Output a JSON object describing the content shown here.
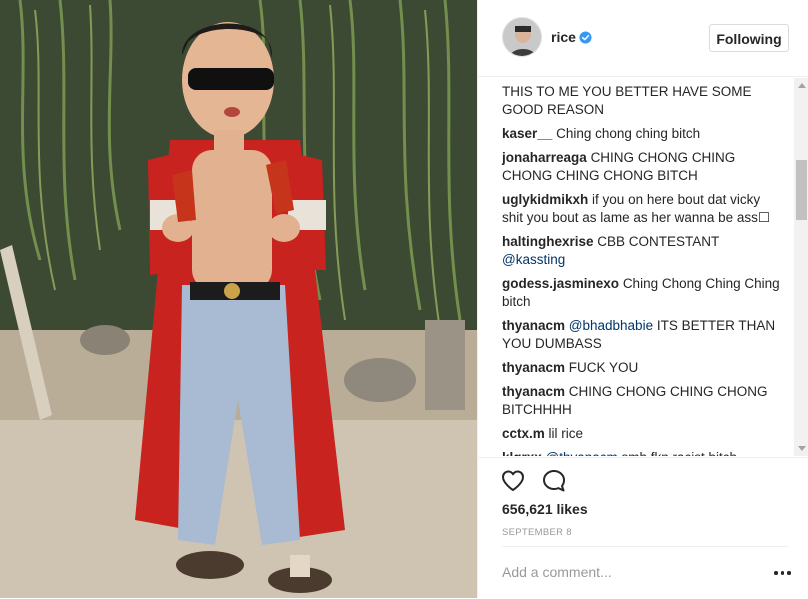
{
  "post": {
    "username": "rice",
    "verified": true,
    "follow_label": "Following",
    "likes_text": "656,621 likes",
    "date_text": "SEPTEMBER 8",
    "add_comment_placeholder": "Add a comment...",
    "photo_alt": "photo"
  },
  "comments": [
    {
      "user": "",
      "parts": [
        {
          "t": "THIS TO ME YOU BETTER HAVE SOME GOOD REASON",
          "m": false
        }
      ]
    },
    {
      "user": "kaser__",
      "parts": [
        {
          "t": "Ching chong ching bitch",
          "m": false
        }
      ]
    },
    {
      "user": "jonaharreaga",
      "parts": [
        {
          "t": "CHING CHONG CHING CHONG CHING CHONG BITCH",
          "m": false
        }
      ]
    },
    {
      "user": "uglykidmikxh",
      "parts": [
        {
          "t": "if you on here bout dat vicky shit you bout as lame as her wanna be ass☐",
          "m": false
        }
      ]
    },
    {
      "user": "haltinghexrise",
      "parts": [
        {
          "t": "CBB CONTESTANT ",
          "m": false
        },
        {
          "t": "@kassting",
          "m": true
        }
      ]
    },
    {
      "user": "godess.jasminexo",
      "parts": [
        {
          "t": "Ching Chong Ching Ching bitch",
          "m": false
        }
      ]
    },
    {
      "user": "thyanacm",
      "parts": [
        {
          "t": "@bhadbhabie",
          "m": true
        },
        {
          "t": " ITS BETTER THAN YOU DUMBASS",
          "m": false
        }
      ]
    },
    {
      "user": "thyanacm",
      "parts": [
        {
          "t": "FUCK YOU",
          "m": false
        }
      ]
    },
    {
      "user": "thyanacm",
      "parts": [
        {
          "t": "CHING CHONG CHING CHONG BITCHHHH",
          "m": false
        }
      ]
    },
    {
      "user": "cctx.m",
      "parts": [
        {
          "t": "lil rice",
          "m": false
        }
      ]
    },
    {
      "user": "klgrxx",
      "parts": [
        {
          "t": "@thyanacm",
          "m": true
        },
        {
          "t": " smh fkn racist bitch",
          "m": false
        }
      ]
    }
  ],
  "icons": {
    "like": "heart-outline-icon",
    "comment": "speech-bubble-icon",
    "verified": "verified-badge-icon",
    "more": "ellipsis-icon"
  },
  "colors": {
    "verified_blue": "#3897f0",
    "text": "#262626",
    "muted": "#999999",
    "mention": "#003569",
    "border": "#efefef"
  }
}
